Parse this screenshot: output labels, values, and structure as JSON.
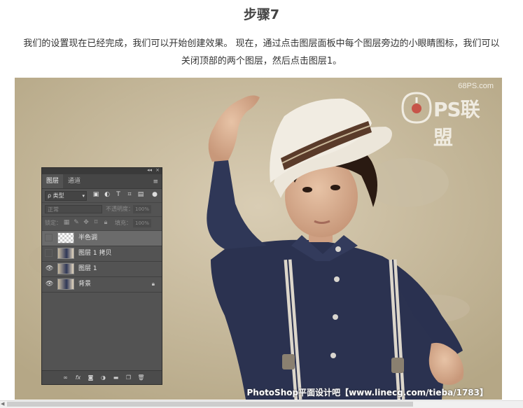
{
  "title": "步骤7",
  "paragraph": {
    "line1": "我们的设置现在已经完成，我们可以开始创建效果。 现在，通过点击图层面板中每个图层旁边的小眼睛图标，我们可以",
    "line2": "关闭顶部的两个图层，然后点击图层1。"
  },
  "photo": {
    "watermark_top": "68PS.com",
    "watermark_logo": "PS联盟",
    "watermark_bottom": "PhotoShop平面设计吧【www.linecg.com/tieba/1783】"
  },
  "panel": {
    "tabs": [
      {
        "label": "图层",
        "active": true
      },
      {
        "label": "通道",
        "active": false
      }
    ],
    "collapse_glyph": "◂◂",
    "close_glyph": "×",
    "filter_label": "ρ 类型",
    "blend_mode": "正常",
    "opacity_label": "不透明度：",
    "opacity_value": "100%",
    "lock_label": "锁定：",
    "fill_label": "填充：",
    "fill_value": "100%",
    "layers": [
      {
        "name": "半色调",
        "visible": false,
        "selected": true,
        "thumb": "checker"
      },
      {
        "name": "图层 1 拷贝",
        "visible": false,
        "selected": false,
        "thumb": "photo"
      },
      {
        "name": "图层 1",
        "visible": true,
        "selected": false,
        "thumb": "photo"
      },
      {
        "name": "背景",
        "visible": true,
        "selected": false,
        "thumb": "photo",
        "locked": true
      }
    ]
  },
  "colors": {
    "panel_bg": "#535353",
    "selected_layer": "#6b6b6b",
    "shirt": "#2b3250",
    "hat": "#ece6da"
  }
}
